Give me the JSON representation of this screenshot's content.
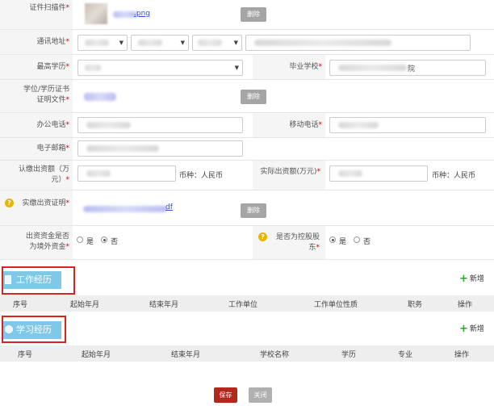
{
  "form": {
    "id_scan": {
      "label": "证件扫描件",
      "file_name": ".png",
      "delete_label": "删除"
    },
    "address": {
      "label": "通讯地址"
    },
    "education": {
      "label": "最高学历",
      "school_label": "毕业学校",
      "school_value_suffix": "院"
    },
    "degree_cert": {
      "label_line1": "学位/学历证书",
      "label_line2": "证明文件",
      "delete_label": "删除"
    },
    "office_phone": {
      "label": "办公电话"
    },
    "mobile": {
      "label": "移动电话"
    },
    "email": {
      "label": "电子邮箱"
    },
    "subscribed": {
      "label_line1": "认缴出资额（万",
      "label_line2": "元）",
      "currency": "币种：人民币"
    },
    "paid_in": {
      "label": "实际出资额(万元)",
      "currency": "币种：人民币"
    },
    "paid_proof": {
      "label": "实缴出资证明",
      "file_name": "df",
      "delete_label": "删除"
    },
    "overseas": {
      "label_line1": "出资资金是否",
      "label_line2": "为境外资金",
      "yes": "是",
      "no": "否",
      "selected": "no"
    },
    "controlling": {
      "label_line1": "是否为控股股",
      "label_line2": "东",
      "yes": "是",
      "no": "否",
      "selected": "yes"
    }
  },
  "work": {
    "title": "工作经历",
    "add_label": "新增",
    "columns": [
      "序号",
      "起始年月",
      "结束年月",
      "工作单位",
      "工作单位性质",
      "职务",
      "操作"
    ]
  },
  "study": {
    "title": "学习经历",
    "add_label": "新增",
    "columns": [
      "序号",
      "起始年月",
      "结束年月",
      "学校名称",
      "学历",
      "专业",
      "操作"
    ]
  },
  "actions": {
    "save": "保存",
    "close": "关闭"
  },
  "required_mark": "*",
  "colors": {
    "tab": "#7ec8e8",
    "highlight_box": "#d9231e",
    "save": "#b3271d",
    "close": "#b0b0b0",
    "add_plus": "#2aa52a"
  }
}
